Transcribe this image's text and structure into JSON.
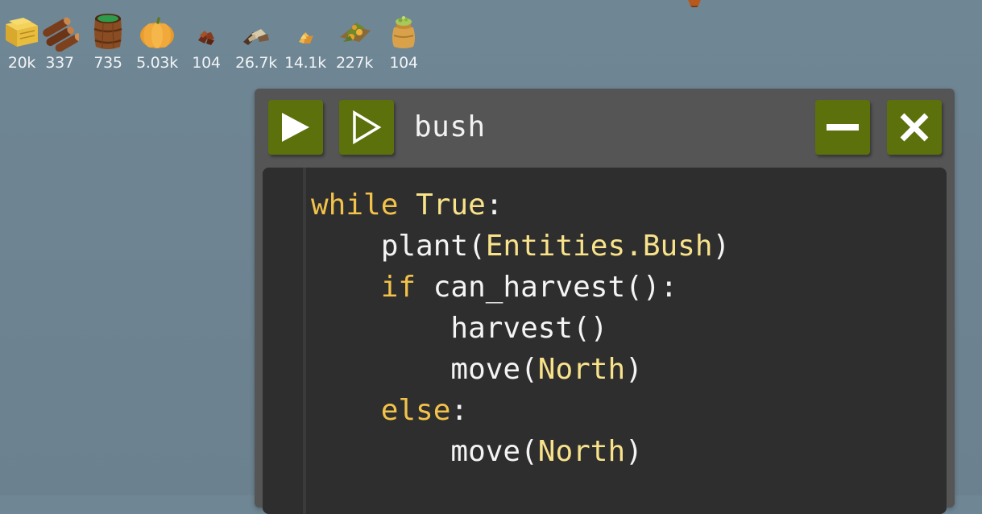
{
  "resources": [
    {
      "icon": "hay-icon",
      "count": "20k"
    },
    {
      "icon": "wood-logs-icon",
      "count": "337"
    },
    {
      "icon": "water-barrel-icon",
      "count": "735"
    },
    {
      "icon": "pumpkin-icon",
      "count": "5.03k"
    },
    {
      "icon": "cactus-icon",
      "count": "104"
    },
    {
      "icon": "bones-icon",
      "count": "26.7k"
    },
    {
      "icon": "weird-substance-icon",
      "count": "14.1k"
    },
    {
      "icon": "gold-icon",
      "count": "227k"
    },
    {
      "icon": "fertilizer-sack-icon",
      "count": "104"
    }
  ],
  "window": {
    "title": "bush",
    "buttons": {
      "run": "play-filled-icon",
      "step": "play-outline-icon",
      "minimize": "minimize-icon",
      "close": "close-icon"
    }
  },
  "code": {
    "lines": [
      {
        "indent": "",
        "tokens": [
          {
            "t": "while",
            "c": "kw"
          },
          {
            "t": " ",
            "c": "plain"
          },
          {
            "t": "True",
            "c": "const"
          },
          {
            "t": ":",
            "c": "plain"
          }
        ]
      },
      {
        "indent": "    ",
        "tokens": [
          {
            "t": "plant(",
            "c": "plain"
          },
          {
            "t": "Entities.Bush",
            "c": "const"
          },
          {
            "t": ")",
            "c": "plain"
          }
        ]
      },
      {
        "indent": "    ",
        "tokens": [
          {
            "t": "if",
            "c": "kw"
          },
          {
            "t": " can_harvest():",
            "c": "plain"
          }
        ]
      },
      {
        "indent": "        ",
        "tokens": [
          {
            "t": "harvest()",
            "c": "plain"
          }
        ]
      },
      {
        "indent": "        ",
        "tokens": [
          {
            "t": "move(",
            "c": "plain"
          },
          {
            "t": "North",
            "c": "const"
          },
          {
            "t": ")",
            "c": "plain"
          }
        ]
      },
      {
        "indent": "    ",
        "tokens": [
          {
            "t": "else",
            "c": "kw"
          },
          {
            "t": ":",
            "c": "plain"
          }
        ]
      },
      {
        "indent": "        ",
        "tokens": [
          {
            "t": "move(",
            "c": "plain"
          },
          {
            "t": "North",
            "c": "const"
          },
          {
            "t": ")",
            "c": "plain"
          }
        ]
      }
    ]
  },
  "colors": {
    "background": "#6f8694",
    "window": "#555555",
    "editor": "#2e2e2e",
    "button": "#5c700c",
    "keyword": "#f2c24a",
    "constant": "#f8e28a",
    "text": "#f4f4f4"
  }
}
